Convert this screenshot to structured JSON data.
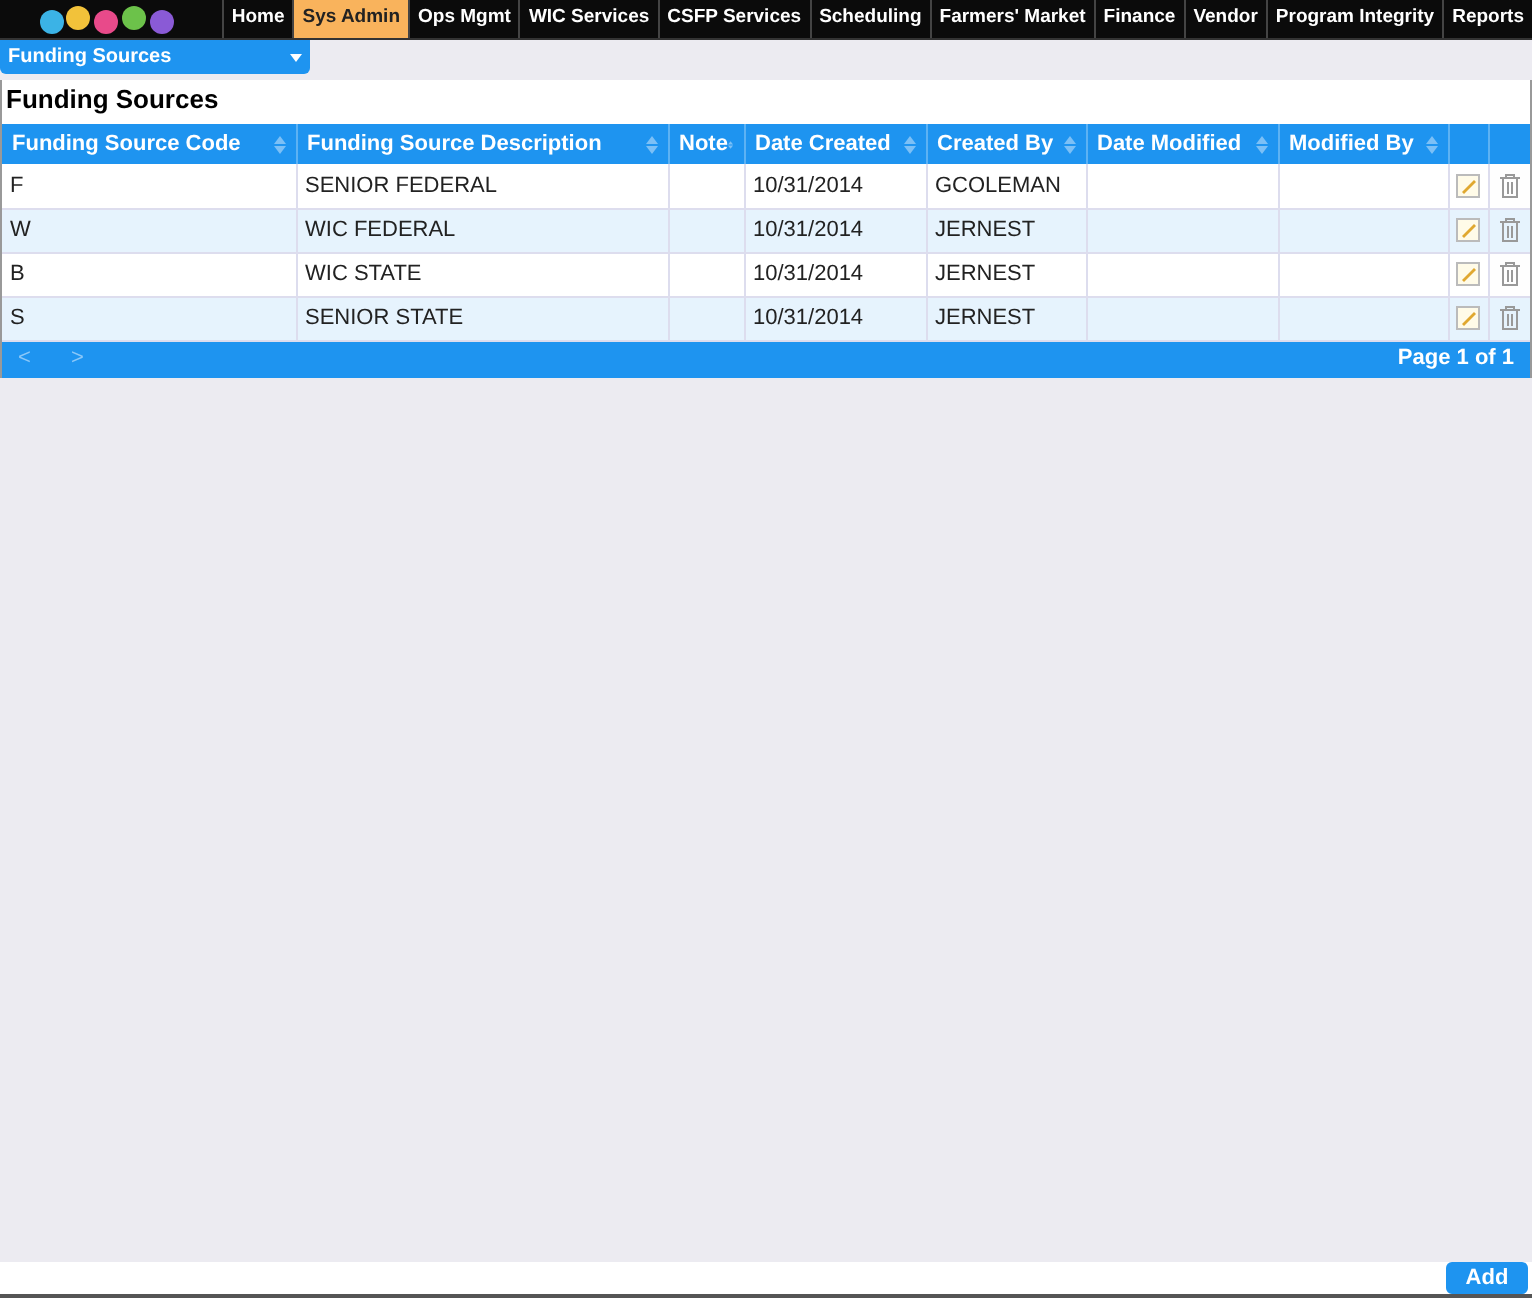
{
  "nav": {
    "tabs": [
      {
        "label": "Home",
        "selected": false
      },
      {
        "label": "Sys Admin",
        "selected": true
      },
      {
        "label": "Ops Mgmt",
        "selected": false
      },
      {
        "label": "WIC Services",
        "selected": false
      },
      {
        "label": "CSFP Services",
        "selected": false
      },
      {
        "label": "Scheduling",
        "selected": false
      },
      {
        "label": "Farmers' Market",
        "selected": false
      },
      {
        "label": "Finance",
        "selected": false
      },
      {
        "label": "Vendor",
        "selected": false
      },
      {
        "label": "Program Integrity",
        "selected": false
      },
      {
        "label": "Reports",
        "selected": false
      }
    ]
  },
  "menu_dropdown": {
    "value": "Funding Sources"
  },
  "page_title": "Funding Sources",
  "table": {
    "columns": [
      "Funding Source Code",
      "Funding Source Description",
      "Note",
      "Date Created",
      "Created By",
      "Date Modified",
      "Modified By"
    ],
    "rows": [
      {
        "cells": [
          "F",
          "SENIOR FEDERAL",
          "",
          "10/31/2014",
          "GCOLEMAN",
          "",
          ""
        ]
      },
      {
        "cells": [
          "W",
          "WIC FEDERAL",
          "",
          "10/31/2014",
          "JERNEST",
          "",
          ""
        ]
      },
      {
        "cells": [
          "B",
          "WIC STATE",
          "",
          "10/31/2014",
          "JERNEST",
          "",
          ""
        ]
      },
      {
        "cells": [
          "S",
          "SENIOR STATE",
          "",
          "10/31/2014",
          "JERNEST",
          "",
          ""
        ]
      }
    ],
    "pager": {
      "prev": "<",
      "next": ">",
      "page_info": "Page 1 of 1"
    }
  },
  "add_button": "Add"
}
